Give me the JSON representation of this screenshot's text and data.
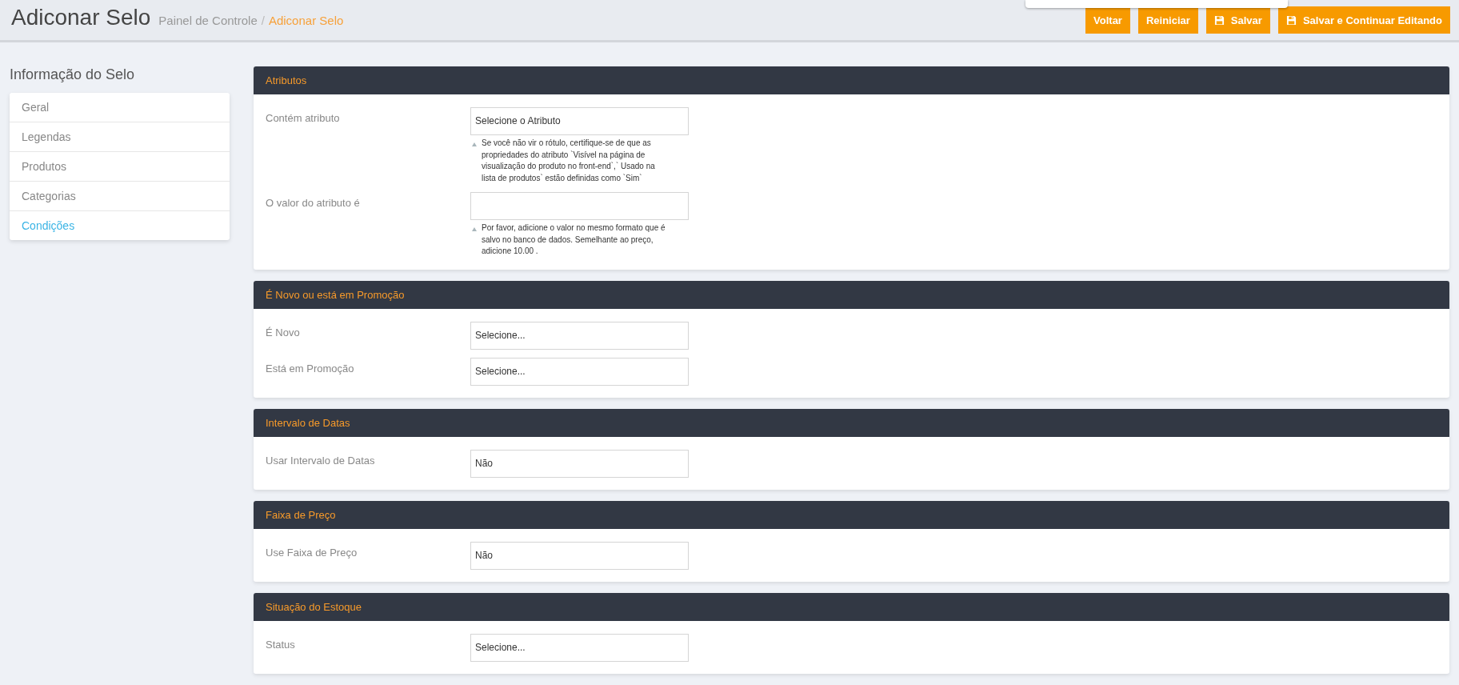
{
  "header": {
    "title": "Adiconar Selo",
    "separator": "/",
    "breadcrumb": [
      {
        "text": "Painel de Controle",
        "current": false
      },
      {
        "text": "Adiconar Selo",
        "current": true
      }
    ],
    "buttons": [
      {
        "label": "Voltar",
        "kind": "plain"
      },
      {
        "label": "Reiniciar",
        "kind": "plain"
      },
      {
        "label": "Salvar",
        "kind": "with-icon"
      },
      {
        "label": "Salvar e Continuar Editando",
        "kind": "with-icon"
      }
    ]
  },
  "sidebar": {
    "title": "Informação do Selo",
    "items": [
      {
        "label": "Geral",
        "selected": false
      },
      {
        "label": "Legendas",
        "selected": false
      },
      {
        "label": "Produtos",
        "selected": false
      },
      {
        "label": "Categorias",
        "selected": false
      },
      {
        "label": "Condições",
        "selected": true
      }
    ]
  },
  "panels": [
    {
      "title": "Atributos",
      "fields": [
        {
          "label": "Contém atributo",
          "value": "Selecione o Atributo",
          "help": "Se você não vir o rótulo, certifique-se de que as propriedades do atributo `Visível na página de visualização do produto no front-end`,` Usado na lista de produtos` estão definidas como `Sim`"
        },
        {
          "label": "O valor do atributo é",
          "help": "Por favor, adicione o valor no mesmo formato que é salvo no banco de dados. Semelhante ao preço, adicione 10.00 ."
        }
      ]
    },
    {
      "title": "É Novo ou está em Promoção",
      "fields": [
        {
          "label": "É Novo",
          "value": "Selecione..."
        },
        {
          "label": "Está em Promoção",
          "value": "Selecione..."
        }
      ]
    },
    {
      "title": "Intervalo de Datas",
      "fields": [
        {
          "label": "Usar Intervalo de Datas",
          "value": "Não"
        }
      ]
    },
    {
      "title": "Faixa de Preço",
      "fields": [
        {
          "label": "Use Faixa de Preço",
          "value": "Não"
        }
      ]
    },
    {
      "title": "Situação do Estoque",
      "fields": [
        {
          "label": "Status",
          "value": "Selecione..."
        }
      ]
    }
  ]
}
